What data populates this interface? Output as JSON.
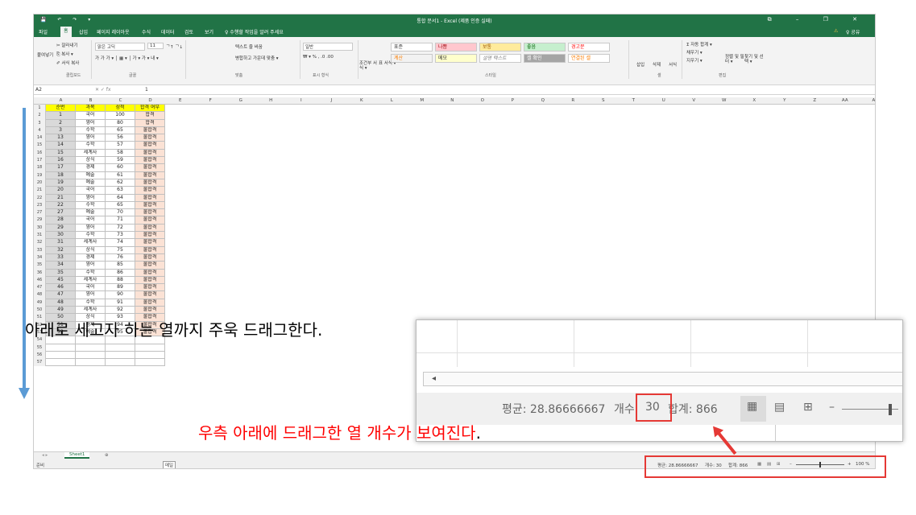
{
  "window": {
    "title": "통합 문서1 - Excel (제품 인증 실패)",
    "qat": "💾 ↶ ↷ ▾",
    "controls": "⧉ – ❐ ✕"
  },
  "menu": {
    "tabs": [
      "파일",
      "홈",
      "삽입",
      "페이지 레이아웃",
      "수식",
      "데이터",
      "검토",
      "보기"
    ],
    "search": "♀ 수행할 작업을 알려 주세요",
    "warning": "⚠",
    "share": "♀ 공유"
  },
  "ribbon": {
    "clipboard": {
      "cut": "✂ 잘라내기",
      "copy": "⎘ 복사 ▾",
      "paste": "붙여넣기",
      "format": "✐ 서식 복사",
      "label": "클립보드"
    },
    "font": {
      "name": "맑은 고딕",
      "size": "11",
      "grow": "ᄀ↑ ᄀ↓",
      "styles": "가 가 가 ▾ │ ▦ ▾ │ 가 ▾ 가 ▾ 내 ▾",
      "label": "글꼴"
    },
    "align": {
      "wrap": "텍스트 줄 바꿈",
      "merge": "병합하고 가운데 맞춤 ▾",
      "label": "맞춤"
    },
    "number": {
      "format": "일반",
      "symbols": "₩ ▾ % , .0 .00",
      "label": "표시 형식"
    },
    "styles": {
      "cond": "조건부 서식 ▾",
      "table": "표 서식 ▾",
      "cells": [
        "표준",
        "나쁨",
        "보통",
        "좋음",
        "경고문",
        "계산",
        "메모",
        "설명 텍스트",
        "셀 확인",
        "연결된 셀"
      ],
      "label": "스타일"
    },
    "cells": {
      "insert": "삽입",
      "delete": "삭제",
      "format": "서식",
      "label": "셀"
    },
    "editing": {
      "sum": "Σ 자동 합계 ▾",
      "fill": "채우기 ▾",
      "clear": "지우기 ▾",
      "sort": "정렬 및 필터 ▾",
      "find": "찾기 및 선택 ▾",
      "label": "편집"
    }
  },
  "formula_bar": {
    "name_box": "A2",
    "icons": "✕ ✓ fx",
    "value": "1"
  },
  "columns": [
    "A",
    "B",
    "C",
    "D",
    "E",
    "F",
    "G",
    "H",
    "I",
    "J",
    "K",
    "L",
    "M",
    "N",
    "O",
    "P",
    "Q",
    "R",
    "S",
    "T",
    "U",
    "V",
    "W",
    "X",
    "Y",
    "Z",
    "AA",
    "AB"
  ],
  "table": {
    "headers": [
      "순번",
      "과목",
      "성적",
      "합격 여부"
    ],
    "rows": [
      {
        "row": "2",
        "n": "1",
        "subj": "국어",
        "score": "100",
        "pass": "합격"
      },
      {
        "row": "3",
        "n": "2",
        "subj": "영어",
        "score": "80",
        "pass": "합격"
      },
      {
        "row": "4",
        "n": "3",
        "subj": "수학",
        "score": "65",
        "pass": "불합격"
      },
      {
        "row": "14",
        "n": "13",
        "subj": "영어",
        "score": "56",
        "pass": "불합격"
      },
      {
        "row": "15",
        "n": "14",
        "subj": "수학",
        "score": "57",
        "pass": "불합격"
      },
      {
        "row": "16",
        "n": "15",
        "subj": "세계사",
        "score": "58",
        "pass": "불합격"
      },
      {
        "row": "17",
        "n": "16",
        "subj": "상식",
        "score": "59",
        "pass": "불합격"
      },
      {
        "row": "18",
        "n": "17",
        "subj": "경제",
        "score": "60",
        "pass": "불합격"
      },
      {
        "row": "19",
        "n": "18",
        "subj": "예술",
        "score": "61",
        "pass": "불합격"
      },
      {
        "row": "20",
        "n": "19",
        "subj": "예술",
        "score": "62",
        "pass": "불합격"
      },
      {
        "row": "21",
        "n": "20",
        "subj": "국어",
        "score": "63",
        "pass": "불합격"
      },
      {
        "row": "22",
        "n": "21",
        "subj": "영어",
        "score": "64",
        "pass": "불합격"
      },
      {
        "row": "23",
        "n": "22",
        "subj": "수학",
        "score": "65",
        "pass": "불합격"
      },
      {
        "row": "27",
        "n": "27",
        "subj": "예술",
        "score": "70",
        "pass": "불합격"
      },
      {
        "row": "29",
        "n": "28",
        "subj": "국어",
        "score": "71",
        "pass": "불합격"
      },
      {
        "row": "30",
        "n": "29",
        "subj": "영어",
        "score": "72",
        "pass": "불합격"
      },
      {
        "row": "31",
        "n": "30",
        "subj": "수학",
        "score": "73",
        "pass": "불합격"
      },
      {
        "row": "32",
        "n": "31",
        "subj": "세계사",
        "score": "74",
        "pass": "불합격"
      },
      {
        "row": "33",
        "n": "32",
        "subj": "상식",
        "score": "75",
        "pass": "불합격"
      },
      {
        "row": "34",
        "n": "33",
        "subj": "경제",
        "score": "76",
        "pass": "불합격"
      },
      {
        "row": "35",
        "n": "34",
        "subj": "영어",
        "score": "85",
        "pass": "불합격"
      },
      {
        "row": "36",
        "n": "35",
        "subj": "수학",
        "score": "86",
        "pass": "불합격"
      },
      {
        "row": "46",
        "n": "45",
        "subj": "세계사",
        "score": "88",
        "pass": "불합격"
      },
      {
        "row": "47",
        "n": "46",
        "subj": "국어",
        "score": "89",
        "pass": "불합격"
      },
      {
        "row": "48",
        "n": "47",
        "subj": "영어",
        "score": "90",
        "pass": "불합격"
      },
      {
        "row": "49",
        "n": "48",
        "subj": "수학",
        "score": "91",
        "pass": "불합격"
      },
      {
        "row": "50",
        "n": "49",
        "subj": "세계사",
        "score": "92",
        "pass": "불합격"
      },
      {
        "row": "51",
        "n": "50",
        "subj": "상식",
        "score": "93",
        "pass": "불합격"
      },
      {
        "row": "52",
        "n": "51",
        "subj": "경제",
        "score": "94",
        "pass": "불합격"
      },
      {
        "row": "53",
        "n": "52",
        "subj": "예술",
        "score": "95",
        "pass": "불합격"
      }
    ],
    "empty_rows": [
      "54",
      "55",
      "56",
      "57"
    ]
  },
  "sheets": {
    "nav": "◂ ▸",
    "tab": "Sheet1",
    "add": "⊕"
  },
  "status": {
    "mode": "준비",
    "mode2": "메일",
    "avg": "평균: 28.86666667",
    "count": "개수: 30",
    "sum": "합계: 866",
    "zoom": "100 %",
    "minus": "–",
    "plus": "+"
  },
  "zoom_panel": {
    "avg": "평균: 28.86666667",
    "count_label": "개수: ",
    "count": "30",
    "sum": "합계: 866"
  },
  "annotations": {
    "drag": "아래로 세고자 하는 열까지 주욱 드래그한다.",
    "count_note": "우측 아래에 드래그한 열 개수가 보여진다",
    "period": "."
  },
  "colors": {
    "excel_green": "#217346",
    "header_yellow": "#ffff00",
    "pass_fill": "#fbe2d5",
    "arrow_blue": "#5b9bd5",
    "annotation_red": "#ff0000"
  }
}
